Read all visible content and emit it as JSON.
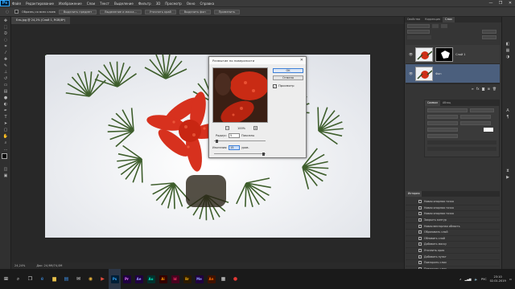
{
  "menubar": {
    "logo": "Ps",
    "items": [
      "Файл",
      "Редактирование",
      "Изображение",
      "Слои",
      "Текст",
      "Выделение",
      "Фильтр",
      "3D",
      "Просмотр",
      "Окно",
      "Справка"
    ],
    "win": [
      "—",
      "❐",
      "✕"
    ]
  },
  "options": {
    "check_label": "Образец со всех слоев",
    "buttons": [
      "Выделить предмет",
      "Выделение и маска...",
      "Уточнить край",
      "Выделить фон",
      "Применить"
    ]
  },
  "doc": {
    "tab": "Ель.jpg @ 24,2% (Слой 1, RGB/8*)",
    "zoom": "24,24%",
    "docinfo": "Док: 24,9M/74,0M"
  },
  "dialog": {
    "title": "Размытие по поверхности",
    "close": "✕",
    "ok": "OK",
    "cancel": "Отмена",
    "preview_check": "✓",
    "preview": "Просмотр",
    "zoom_minus": "−",
    "zoom": "100%",
    "zoom_plus": "+",
    "radius_label": "Радиус:",
    "radius": "5",
    "radius_unit": "Пикселы",
    "threshold_label": "Изогелия:",
    "threshold": "15",
    "threshold_unit": "уров."
  },
  "panels": {
    "layers_tabs": [
      "Свойства",
      "Коррекция",
      "Слои"
    ],
    "layers": [
      {
        "name": "Слой 1"
      },
      {
        "name": "Фон"
      }
    ],
    "char_tabs": [
      "Символ",
      "Абзац"
    ],
    "history_tab": "История",
    "history": [
      "Новая опорная точка",
      "Новая опорная точка",
      "Новая опорная точка",
      "Закрыть контур",
      "Новая векторная область",
      "Образовать слой",
      "Обновить слой",
      "Добавить маску",
      "Уточнить края",
      "Добавить пункт",
      "Повторить слои",
      "Повторить слои",
      "Подсказки"
    ]
  },
  "taskbar": {
    "time": "23:10",
    "date": "02.01.2019",
    "lang": "РУС",
    "apps": [
      "Ps",
      "Pr",
      "Ae",
      "Au",
      "Ai",
      "Id",
      "Br",
      "Me",
      "An"
    ]
  },
  "colors": {
    "ps_blue": "#31a8ff",
    "accent": "#3c7fd8"
  }
}
